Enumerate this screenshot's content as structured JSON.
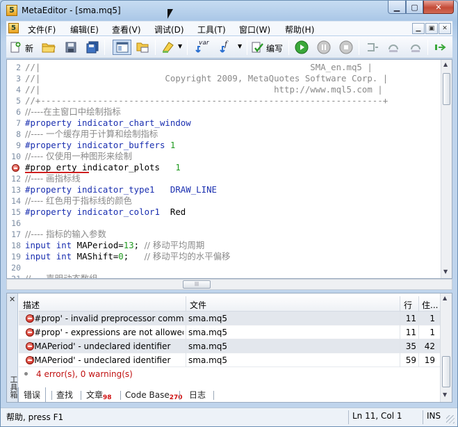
{
  "window": {
    "title": "MetaEditor - [sma.mq5]",
    "app_icon_glyph": "5",
    "min_glyph": "▁",
    "max_glyph": "▢",
    "close_glyph": "✕"
  },
  "menu": {
    "items": [
      "文件(F)",
      "编辑(E)",
      "查看(V)",
      "调试(D)",
      "工具(T)",
      "窗口(W)",
      "帮助(H)"
    ],
    "mdi_glyphs": [
      "▁",
      "▣",
      "✕"
    ]
  },
  "toolbar": {
    "new_label": "新",
    "compile_label": "编写",
    "var_label": "var",
    "f_label": "f"
  },
  "editor": {
    "lines": [
      {
        "n": "2",
        "text": "//|                                                    SMA_en.mq5 |"
      },
      {
        "n": "3",
        "text": "//|                        Copyright 2009, MetaQuotes Software Corp. |"
      },
      {
        "n": "4",
        "text": "//|                                             http://www.mql5.com |"
      },
      {
        "n": "5",
        "text": "//+------------------------------------------------------------------+"
      },
      {
        "n": "6",
        "text": "//----在主窗口中绘制指标"
      },
      {
        "n": "7",
        "kw": "#property indicator_chart_window"
      },
      {
        "n": "8",
        "text": "//---- 一个缓存用于计算和绘制指标"
      },
      {
        "n": "9",
        "kw": "#property indicator_buffers ",
        "num": "1"
      },
      {
        "n": "10",
        "text": "//---- 仅使用一种图形来绘制"
      },
      {
        "n": "",
        "plain": "#prop erty indicator_plots   ",
        "num": "1",
        "error": true
      },
      {
        "n": "12",
        "text": "//---- 画指标线"
      },
      {
        "n": "13",
        "kw": "#property indicator_type1   DRAW_LINE"
      },
      {
        "n": "14",
        "text": "//---- 红色用于指标线的颜色"
      },
      {
        "n": "15",
        "kw": "#property indicator_color1  ",
        "plain2": "Red"
      },
      {
        "n": "16",
        "text": ""
      },
      {
        "n": "17",
        "text": "//---- 指标的输入参数"
      },
      {
        "n": "18",
        "kw": "input int ",
        "plain2": "MAPeriod=",
        "num2": "13",
        "plain3": "; ",
        "com": "// 移动平均周期"
      },
      {
        "n": "19",
        "kw": "input int ",
        "plain2": "MAShift=",
        "num2": "0",
        "plain3": ";   ",
        "com": "// 移动平均的水平偏移"
      },
      {
        "n": "20",
        "text": ""
      },
      {
        "n": "21",
        "text": "//---- 声明动态数组"
      }
    ]
  },
  "toolbox": {
    "close_glyph": "✕",
    "title": "工具箱",
    "headers": {
      "desc": "描述",
      "file": "文件",
      "line": "行",
      "col": "住..."
    },
    "rows": [
      {
        "desc": "'#prop' - invalid preprocessor command",
        "file": "sma.mq5",
        "line": "11",
        "col": "1",
        "selected": true
      },
      {
        "desc": "'#prop' - expressions are not allowed o...",
        "file": "sma.mq5",
        "line": "11",
        "col": "1",
        "selected": false
      },
      {
        "desc": "'MAPeriod' - undeclared identifier",
        "file": "sma.mq5",
        "line": "35",
        "col": "42",
        "selected": true
      },
      {
        "desc": "'MAPeriod' - undeclared identifier",
        "file": "sma.mq5",
        "line": "59",
        "col": "19",
        "selected": false
      }
    ],
    "summary": "4 error(s), 0 warning(s)",
    "tabs": [
      {
        "label": "错误",
        "badge": ""
      },
      {
        "label": "查找",
        "badge": ""
      },
      {
        "label": "文章",
        "badge": "98"
      },
      {
        "label": "Code Base",
        "badge": "270"
      },
      {
        "label": "日志",
        "badge": ""
      }
    ]
  },
  "status": {
    "help": "帮助, press F1",
    "position": "Ln 11, Col 1",
    "mode": "INS"
  },
  "colors": {
    "keyword": "#1a2fb0",
    "comment": "#8a8a8a",
    "number": "#1f9a1f",
    "error": "#c01010"
  }
}
